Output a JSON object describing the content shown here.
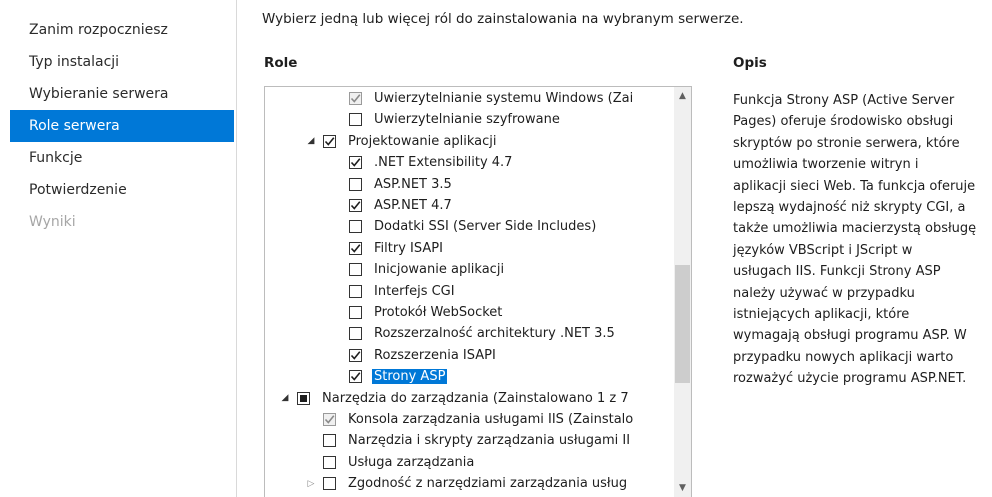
{
  "nav": {
    "items": [
      {
        "label": "Zanim rozpoczniesz",
        "state": "normal"
      },
      {
        "label": "Typ instalacji",
        "state": "normal"
      },
      {
        "label": "Wybieranie serwera",
        "state": "normal"
      },
      {
        "label": "Role serwera",
        "state": "selected"
      },
      {
        "label": "Funkcje",
        "state": "normal"
      },
      {
        "label": "Potwierdzenie",
        "state": "normal"
      },
      {
        "label": "Wyniki",
        "state": "disabled"
      }
    ]
  },
  "main": {
    "instruction": "Wybierz jedną lub więcej ról do zainstalowania na wybranym serwerze.",
    "roles_header": "Role",
    "description_header": "Opis",
    "description": "Funkcja Strony ASP (Active Server\nPages) oferuje środowisko obsługi\nskryptów po stronie serwera, które\numożliwia tworzenie witryn i\naplikacji sieci Web. Ta funkcja oferuje\nlepszą wydajność niż skrypty CGI, a\ntakże umożliwia macierzystą obsługę\njęzyków VBScript i JScript w\nusługach IIS. Funkcji Strony ASP\nnależy używać w przypadku\nistniejących aplikacji, które\nwymagają obsługi programu ASP. W\nprzypadku nowych aplikacji warto\nrozważyć użycie programu ASP.NET."
  },
  "tree": {
    "rows": [
      {
        "label": "Uwierzytelnianie systemu Windows (Zai",
        "level": 4,
        "expander": "",
        "check": "checked-grey"
      },
      {
        "label": "Uwierzytelnianie szyfrowane",
        "level": 4,
        "expander": "",
        "check": "unchecked"
      },
      {
        "label": "Projektowanie aplikacji",
        "level": 3,
        "expander": "collapse",
        "check": "checked"
      },
      {
        "label": ".NET Extensibility 4.7",
        "level": 4,
        "expander": "",
        "check": "checked"
      },
      {
        "label": "ASP.NET 3.5",
        "level": 4,
        "expander": "",
        "check": "unchecked"
      },
      {
        "label": "ASP.NET 4.7",
        "level": 4,
        "expander": "",
        "check": "checked"
      },
      {
        "label": "Dodatki SSI (Server Side Includes)",
        "level": 4,
        "expander": "",
        "check": "unchecked"
      },
      {
        "label": "Filtry ISAPI",
        "level": 4,
        "expander": "",
        "check": "checked"
      },
      {
        "label": "Inicjowanie aplikacji",
        "level": 4,
        "expander": "",
        "check": "unchecked"
      },
      {
        "label": "Interfejs CGI",
        "level": 4,
        "expander": "",
        "check": "unchecked"
      },
      {
        "label": "Protokół WebSocket",
        "level": 4,
        "expander": "",
        "check": "unchecked"
      },
      {
        "label": "Rozszerzalność architektury .NET 3.5",
        "level": 4,
        "expander": "",
        "check": "unchecked"
      },
      {
        "label": "Rozszerzenia ISAPI",
        "level": 4,
        "expander": "",
        "check": "checked"
      },
      {
        "label": "Strony ASP",
        "level": 4,
        "expander": "",
        "check": "checked",
        "selected": true
      },
      {
        "label": "Narzędzia do zarządzania (Zainstalowano 1 z 7",
        "level": 2,
        "expander": "collapse",
        "check": "indeterminate"
      },
      {
        "label": "Konsola zarządzania usługami IIS (Zainstalo",
        "level": 3,
        "expander": "",
        "check": "checked-grey"
      },
      {
        "label": "Narzędzia i skrypty zarządzania usługami II",
        "level": 3,
        "expander": "",
        "check": "unchecked"
      },
      {
        "label": "Usługa zarządzania",
        "level": 3,
        "expander": "",
        "check": "unchecked"
      },
      {
        "label": "Zgodność z narzędziami zarządzania usług",
        "level": 3,
        "expander": "expand",
        "check": "unchecked"
      }
    ]
  },
  "icons": {
    "collapse": "triangle-down-right-icon",
    "expand": "triangle-right-icon",
    "check": "checkmark-icon",
    "scroll_up": "chevron-up-icon",
    "scroll_down": "chevron-down-icon"
  },
  "colors": {
    "selection": "#0078d7",
    "disabled_text": "#a6a6a6",
    "border": "#bcbcbc"
  }
}
